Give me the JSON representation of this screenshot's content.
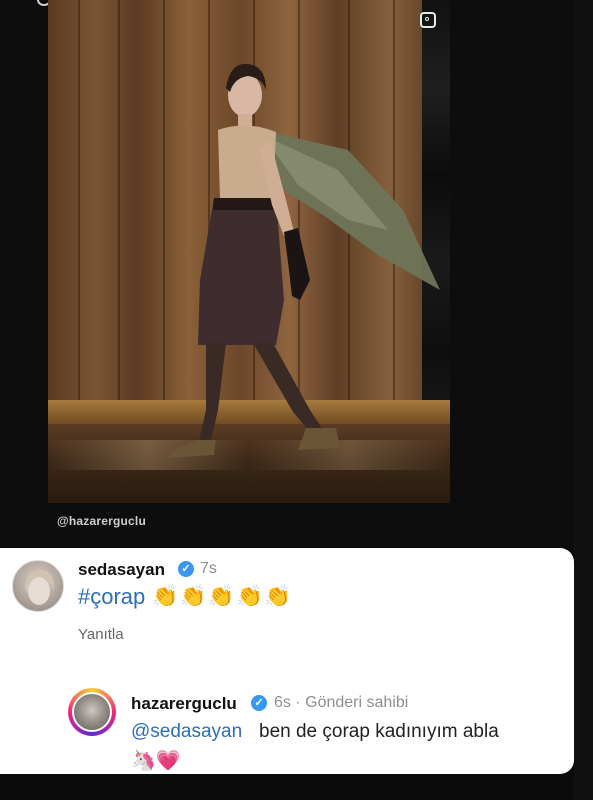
{
  "story": {
    "credit": "@hazarerguclu"
  },
  "comment": {
    "username": "sedasayan",
    "time": "7s",
    "hashtag": "#çorap",
    "claps": "👏👏👏👏👏",
    "reply_label": "Yanıtla"
  },
  "reply": {
    "username": "hazarerguclu",
    "time": "6s · Gönderi sahibi",
    "mention": "@sedasayan",
    "text": "ben de çorap kadınıyım abla",
    "emojis": "🦄💗"
  },
  "colors": {
    "link": "#2b6fb6",
    "verified": "#3897f0"
  },
  "icons": {
    "verified": "verified-badge-icon",
    "story": "square-outline-icon"
  }
}
